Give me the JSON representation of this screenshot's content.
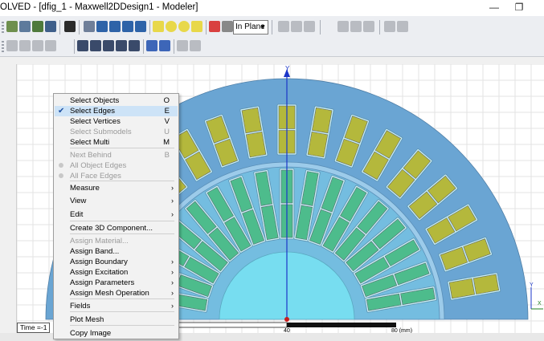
{
  "window": {
    "title": "OLVED - [dfig_1 - Maxwell2DDesign1 - Modeler]",
    "controls": {
      "minimize": "—",
      "restore": "❐",
      "close": "✕"
    }
  },
  "toolbar": {
    "plane_select": "In Plane"
  },
  "canvas": {
    "y_axis_label": "Y",
    "mini_axes": {
      "y": "Y",
      "x": "X"
    },
    "ruler": {
      "mark_40": "40",
      "mark_80": "80 (mm)"
    },
    "time_label": "Time =-1",
    "colors": {
      "stator": "#6aa5d3",
      "air_gap": "#9ccbea",
      "rotor": "#74bde0",
      "shaft": "#77ddf0",
      "slot": "#c8f0f4",
      "stator_coil": "#b4b83c",
      "rotor_coil": "#4dbc8c",
      "axis": "#1b36c8"
    }
  },
  "context_menu": {
    "items": [
      {
        "label": "Select Objects",
        "key": "O",
        "state": "normal"
      },
      {
        "label": "Select Edges",
        "key": "E",
        "state": "selected",
        "checked": true
      },
      {
        "label": "Select Vertices",
        "key": "V",
        "state": "normal"
      },
      {
        "label": "Select Submodels",
        "key": "U",
        "state": "disabled"
      },
      {
        "label": "Select Multi",
        "key": "M",
        "state": "normal"
      },
      {
        "label": "Next Behind",
        "key": "B",
        "state": "disabled"
      },
      {
        "label": "All Object Edges",
        "key": "",
        "state": "disabled",
        "radio": true
      },
      {
        "label": "All Face Edges",
        "key": "",
        "state": "disabled",
        "radio": true
      },
      {
        "label": "Measure",
        "submenu": true
      },
      {
        "label": "View",
        "submenu": true
      },
      {
        "label": "Edit",
        "submenu": true
      },
      {
        "label": "Create 3D Component...",
        "state": "normal"
      },
      {
        "label": "Assign Material...",
        "state": "disabled"
      },
      {
        "label": "Assign Band...",
        "state": "normal"
      },
      {
        "label": "Assign Boundary",
        "submenu": true
      },
      {
        "label": "Assign Excitation",
        "submenu": true
      },
      {
        "label": "Assign Parameters",
        "submenu": true
      },
      {
        "label": "Assign Mesh Operation",
        "submenu": true
      },
      {
        "label": "Fields",
        "submenu": true
      },
      {
        "label": "Plot Mesh",
        "state": "normal"
      },
      {
        "label": "Copy Image",
        "state": "normal"
      }
    ],
    "submenu_arrow": "›",
    "check_mark": "✔"
  }
}
